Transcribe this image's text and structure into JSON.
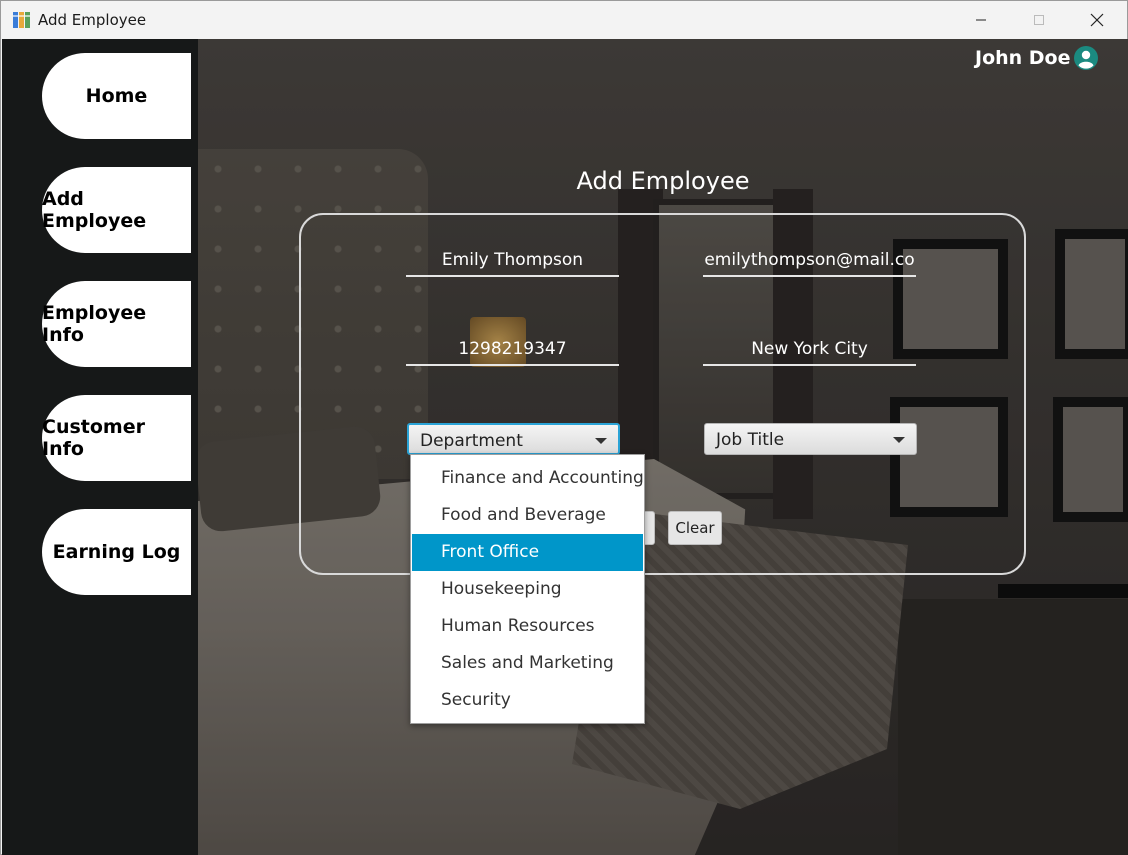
{
  "window": {
    "title": "Add Employee"
  },
  "sidebar": {
    "items": [
      {
        "label": "Home"
      },
      {
        "label": "Add Employee"
      },
      {
        "label": "Employee Info"
      },
      {
        "label": "Customer Info"
      },
      {
        "label": "Earning Log"
      }
    ]
  },
  "header": {
    "user_name": "John Doe",
    "avatar_icon": "user-circle-icon"
  },
  "main": {
    "title": "Add Employee",
    "fields": {
      "name": "Emily Thompson",
      "email": "emilythompson@mail.co",
      "phone": "1298219347",
      "city": "New York City"
    },
    "department_combo": {
      "value": "Department",
      "options": [
        "Finance and Accounting",
        "Food and Beverage",
        "Front Office",
        "Housekeeping",
        "Human Resources",
        "Sales and Marketing",
        "Security"
      ],
      "highlighted": "Front Office"
    },
    "job_title_combo": {
      "value": "Job Title"
    },
    "clear_label": "Clear"
  },
  "colors": {
    "sidebar_bg": "#161818",
    "accent": "#0096c9",
    "avatar": "#1b8a80"
  }
}
